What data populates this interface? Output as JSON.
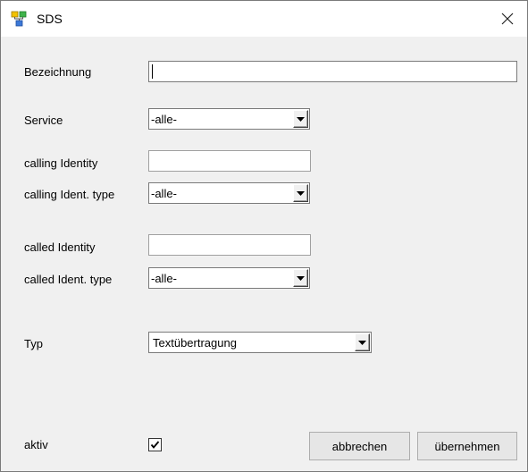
{
  "window": {
    "title": "SDS"
  },
  "form": {
    "bezeichnung": {
      "label": "Bezeichnung",
      "value": ""
    },
    "service": {
      "label": "Service",
      "value": "-alle-"
    },
    "calling_identity": {
      "label": "calling Identity",
      "value": ""
    },
    "calling_ident_type": {
      "label": "calling Ident. type",
      "value": "-alle-"
    },
    "called_identity": {
      "label": "called Identity",
      "value": ""
    },
    "called_ident_type": {
      "label": "called Ident. type",
      "value": "-alle-"
    },
    "typ": {
      "label": "Typ",
      "value": "Textübertragung"
    },
    "aktiv": {
      "label": "aktiv",
      "checked": true
    }
  },
  "buttons": {
    "cancel_label": "abbrechen",
    "apply_label": "übernehmen"
  },
  "icons": {
    "app": "app-network-icon",
    "close": "close-icon",
    "dropdown": "chevron-down-icon",
    "check": "checkmark-icon"
  }
}
